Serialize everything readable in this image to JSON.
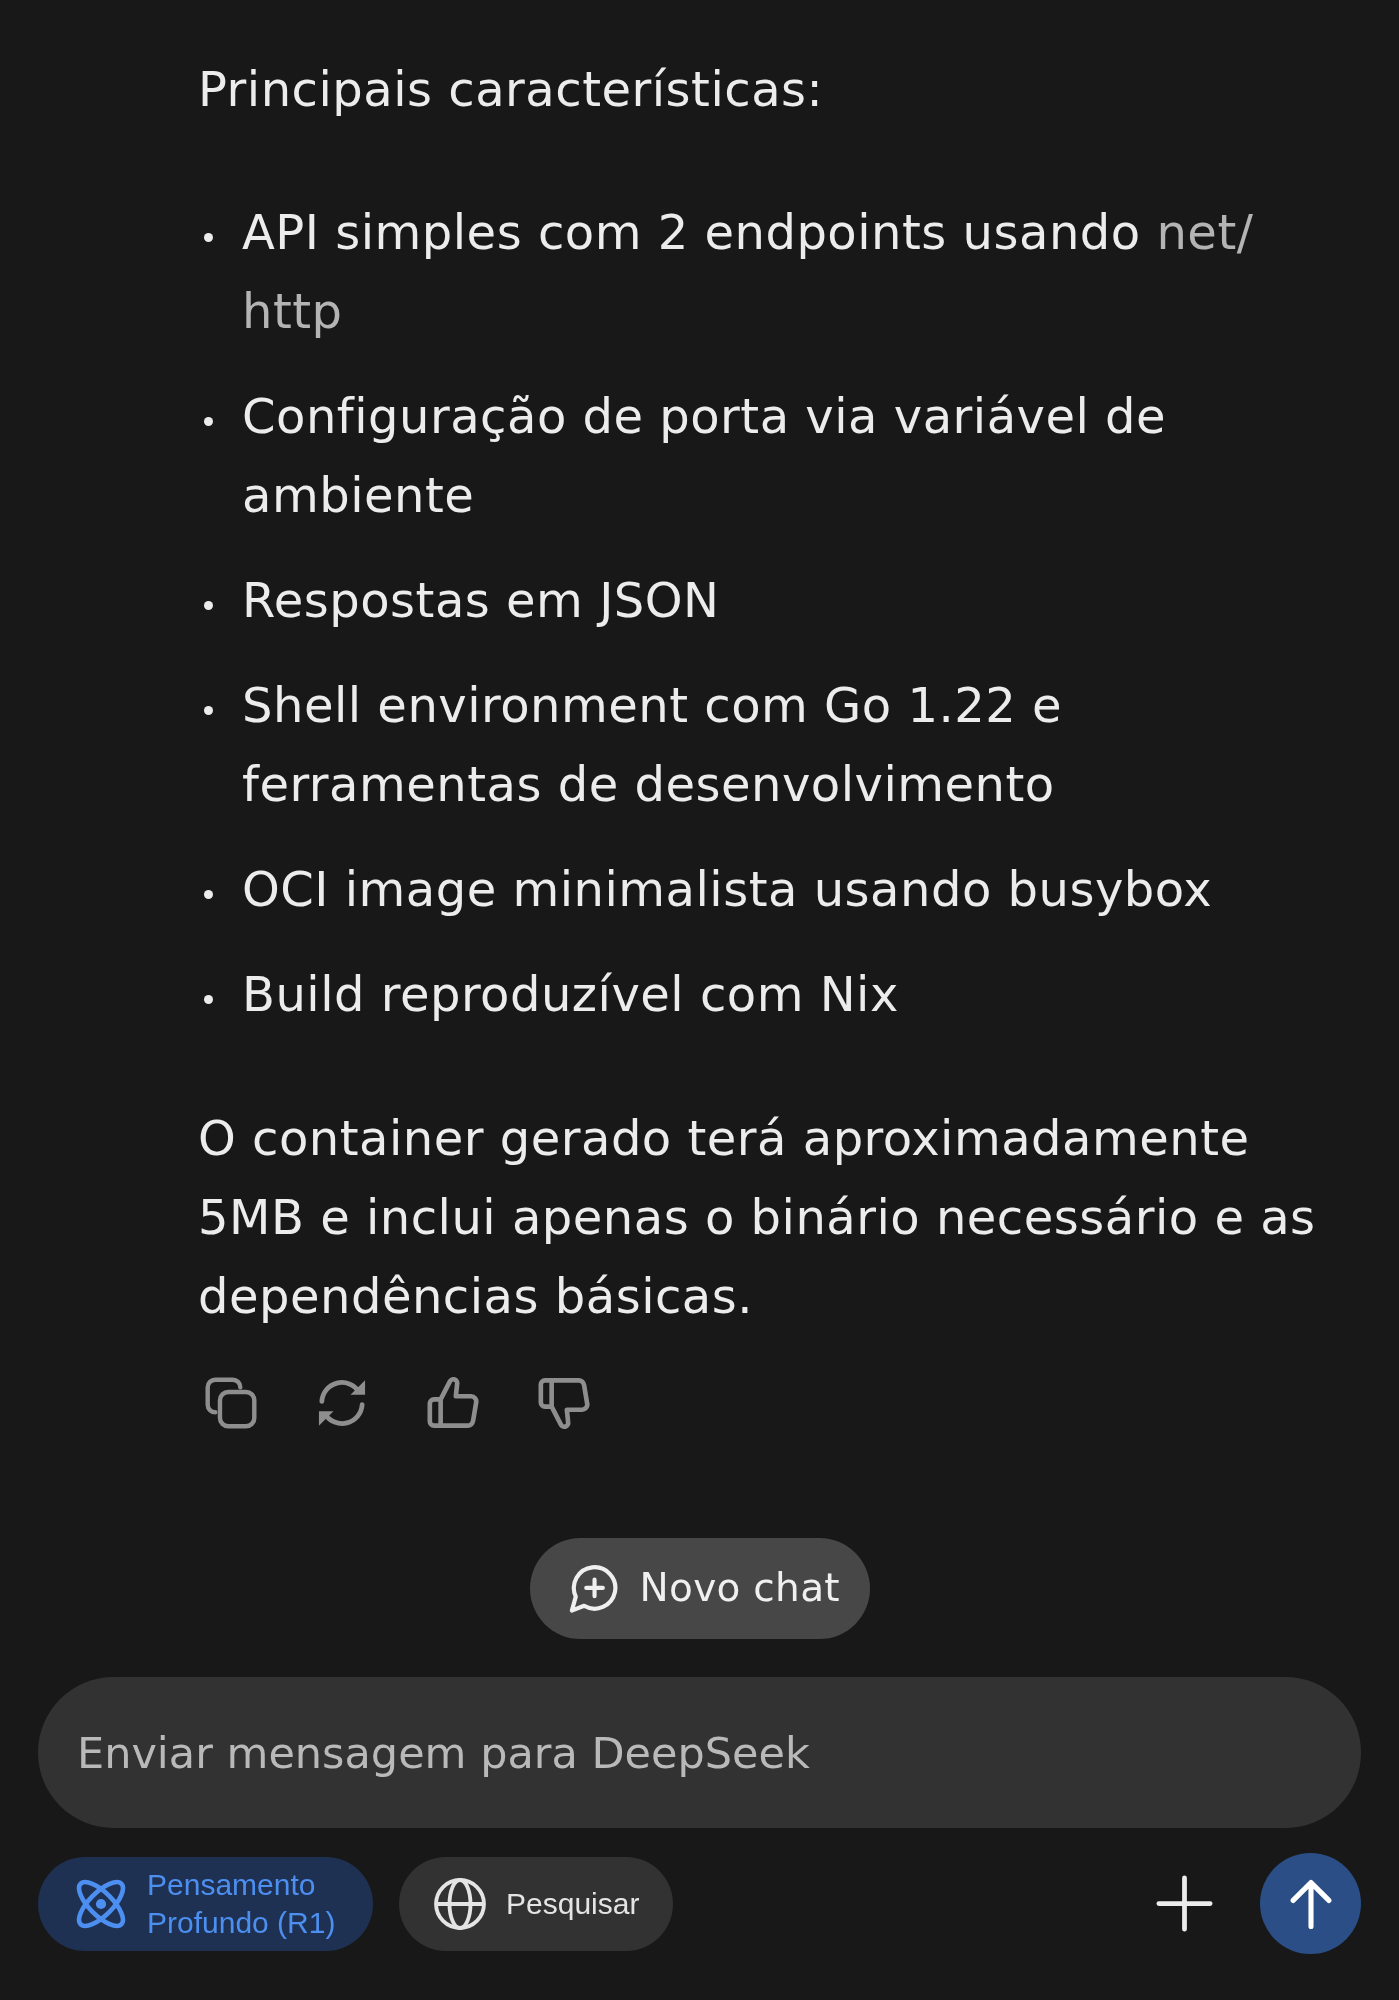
{
  "message": {
    "heading": "Principais características:",
    "bullets": [
      {
        "parts": [
          {
            "kind": "text",
            "text": "API simples com 2 endpoints usando "
          },
          {
            "kind": "code",
            "text": "net/http"
          }
        ]
      },
      {
        "parts": [
          {
            "kind": "text",
            "text": "Configuração de porta via variável de ambiente"
          }
        ]
      },
      {
        "parts": [
          {
            "kind": "text",
            "text": "Respostas em JSON"
          }
        ]
      },
      {
        "parts": [
          {
            "kind": "text",
            "text": "Shell environment com Go 1.22 e ferramentas de desenvolvimento"
          }
        ]
      },
      {
        "parts": [
          {
            "kind": "text",
            "text": "OCI image minimalista usando busybox"
          }
        ]
      },
      {
        "parts": [
          {
            "kind": "text",
            "text": "Build reproduzível com Nix"
          }
        ]
      }
    ],
    "closing": "O container gerado terá aproximadamente 5MB e inclui apenas o binário necessário e as dependências básicas."
  },
  "new_chat_button": {
    "label": "Novo chat"
  },
  "composer": {
    "placeholder": "Enviar mensagem para DeepSeek"
  },
  "toggles": [
    {
      "kind": "deep-think",
      "label": "Pensamento Profundo (R1)",
      "on": true
    },
    {
      "kind": "search",
      "label": "Pesquisar",
      "on": false
    }
  ]
}
